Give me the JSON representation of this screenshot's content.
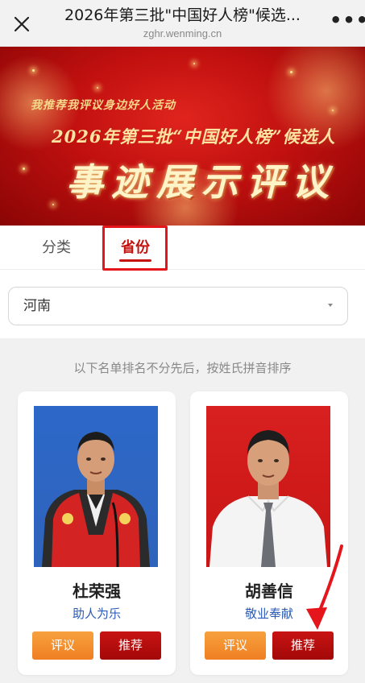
{
  "topbar": {
    "title": "2026年第三批\"中国好人榜\"候选...",
    "domain": "zghr.wenming.cn",
    "close_icon": "close-icon",
    "more_icon": "more-icon",
    "more_label": "•••"
  },
  "banner": {
    "subtitle": "我推荐我评议身边好人活动",
    "line2": "2026年第三批“中国好人榜”候选人",
    "main": "事迹展示评议",
    "colors": {
      "bg": "#c0100f",
      "text": "#fbe3a1"
    }
  },
  "tabs": [
    {
      "label": "分类",
      "active": false
    },
    {
      "label": "省份",
      "active": true
    }
  ],
  "filter": {
    "selected": "河南",
    "arrow_icon": "caret-down-icon"
  },
  "notice": "以下名单排名不分先后，按姓氏拼音排序",
  "candidates": [
    {
      "name": "杜荣强",
      "tag": "助人为乐",
      "comment_label": "评议",
      "recommend_label": "推荐",
      "photo_bg": "#2d68c9"
    },
    {
      "name": "胡善信",
      "tag": "敬业奉献",
      "comment_label": "评议",
      "recommend_label": "推荐",
      "photo_bg": "#d82020"
    }
  ],
  "colors": {
    "accent_red": "#c4120f",
    "highlight": "#e4161c",
    "comment_orange": "#ef7f22",
    "tag_blue": "#2b5bb5"
  }
}
